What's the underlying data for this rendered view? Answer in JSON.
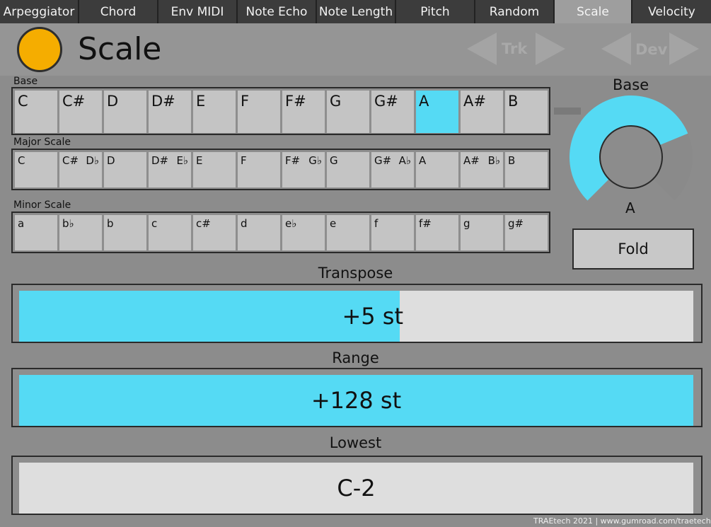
{
  "tabs": [
    {
      "label": "Arpeggiator",
      "active": false
    },
    {
      "label": "Chord",
      "active": false
    },
    {
      "label": "Env MIDI",
      "active": false
    },
    {
      "label": "Note Echo",
      "active": false
    },
    {
      "label": "Note Length",
      "active": false
    },
    {
      "label": "Pitch",
      "active": false
    },
    {
      "label": "Random",
      "active": false
    },
    {
      "label": "Scale",
      "active": true
    },
    {
      "label": "Velocity",
      "active": false
    }
  ],
  "header": {
    "title": "Scale",
    "nav_trk": "Trk",
    "nav_dev": "Dev"
  },
  "sections": {
    "base_label": "Base",
    "major_label": "Major Scale",
    "minor_label": "Minor Scale"
  },
  "base_notes": [
    "C",
    "C#",
    "D",
    "D#",
    "E",
    "F",
    "F#",
    "G",
    "G#",
    "A",
    "A#",
    "B"
  ],
  "base_selected": "A",
  "major_notes": [
    {
      "name": "C",
      "alt": ""
    },
    {
      "name": "C#",
      "alt": "D♭"
    },
    {
      "name": "D",
      "alt": ""
    },
    {
      "name": "D#",
      "alt": "E♭"
    },
    {
      "name": "E",
      "alt": ""
    },
    {
      "name": "F",
      "alt": ""
    },
    {
      "name": "F#",
      "alt": "G♭"
    },
    {
      "name": "G",
      "alt": ""
    },
    {
      "name": "G#",
      "alt": "A♭"
    },
    {
      "name": "A",
      "alt": ""
    },
    {
      "name": "A#",
      "alt": "B♭"
    },
    {
      "name": "B",
      "alt": ""
    }
  ],
  "minor_notes": [
    "a",
    "b♭",
    "b",
    "c",
    "c#",
    "d",
    "e♭",
    "e",
    "f",
    "f#",
    "g",
    "g#"
  ],
  "knob": {
    "label": "Base",
    "value": "A",
    "fraction": 0.75
  },
  "fold_label": "Fold",
  "transpose": {
    "label": "Transpose",
    "value": "+5 st",
    "fraction": 0.565
  },
  "range": {
    "label": "Range",
    "value": "+128 st",
    "fraction": 1.0
  },
  "lowest": {
    "label": "Lowest",
    "value": "C-2",
    "fraction": 0.0
  },
  "colors": {
    "accent": "#55daf4",
    "orb": "#f5ad00",
    "panel": "#8c8c8c"
  },
  "footer": "TRAEtech 2021  |  www.gumroad.com/traetech"
}
